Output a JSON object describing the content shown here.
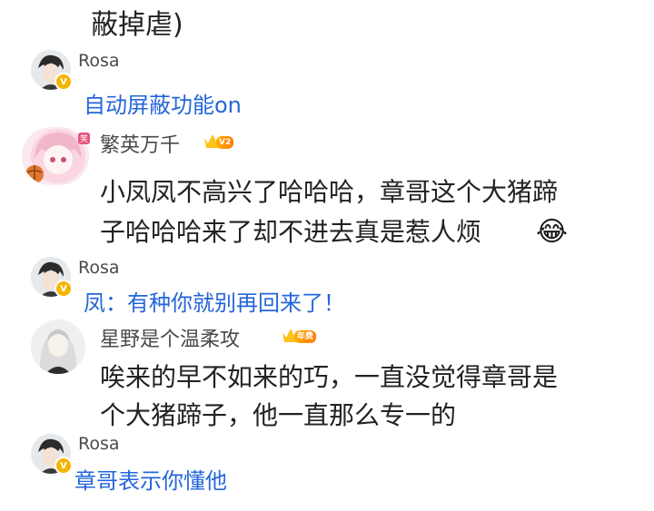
{
  "top_text": "蔽掉虐)",
  "comments": [
    {
      "user": "Rosa",
      "badge": "V",
      "text": "自动屏蔽功能on",
      "type": "reply"
    },
    {
      "user": "繁英万千",
      "level_badge": "V2",
      "avatar_tag": "笑",
      "text_line1": "小凤凤不高兴了哈哈哈，章哥这个大猪蹄",
      "text_line2": "子哈哈哈来了却不进去真是惹人烦",
      "emoji": "😂",
      "type": "comment"
    },
    {
      "user": "Rosa",
      "badge": "V",
      "text": "凤：有种你就别再回来了！",
      "type": "reply"
    },
    {
      "user": "星野是个温柔攻",
      "level_badge": "年费",
      "text_line1": "唉来的早不如来的巧，一直没觉得章哥是",
      "text_line2": "个大猪蹄子，他一直那么专一的",
      "type": "comment"
    },
    {
      "user": "Rosa",
      "badge": "V",
      "text": "章哥表示你懂他",
      "type": "reply"
    }
  ],
  "icons": {
    "avatar": "user-avatar-icon",
    "verified": "verified-v-icon",
    "crown": "crown-level-icon",
    "emoji": "laughing-tears-emoji-icon"
  },
  "colors": {
    "reply_text": "#2466d8",
    "name_text": "#4a4a4a",
    "badge_gold": "#f5b400"
  }
}
